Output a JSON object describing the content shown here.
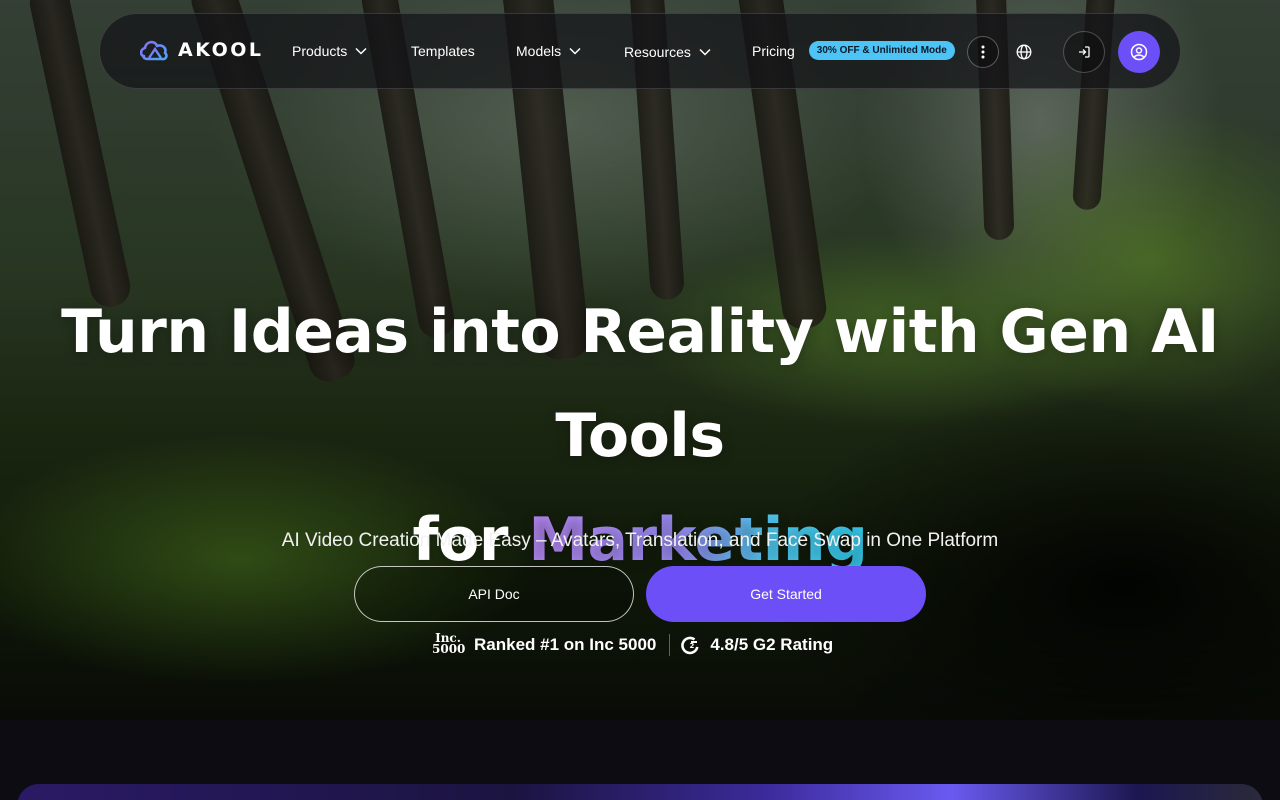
{
  "brand": {
    "name": "AKOOL"
  },
  "nav": {
    "items": [
      {
        "label": "Products",
        "has_dropdown": true
      },
      {
        "label": "Templates",
        "has_dropdown": false
      },
      {
        "label": "Models",
        "has_dropdown": true
      },
      {
        "label": "Resources",
        "has_dropdown": true
      },
      {
        "label": "Pricing",
        "has_dropdown": false
      }
    ],
    "pricing_badge": "30% OFF & Unlimited Mode",
    "icons": [
      "more-vertical-icon",
      "globe-icon",
      "login-icon",
      "user-icon"
    ]
  },
  "hero": {
    "headline_line1": "Turn Ideas into Reality with Gen AI Tools",
    "headline_line2_prefix": "for ",
    "headline_line2_accent": "Marketing",
    "subhead": "AI Video Creation Made Easy – Avatars, Translation, and Face Swap in One Platform",
    "cta_secondary": "API Doc",
    "cta_primary": "Get Started",
    "proof": {
      "inc_logo_top": "Inc.",
      "inc_logo_bottom": "5000",
      "inc_text": "Ranked #1 on Inc 5000",
      "g2_text": "4.8/5 G2 Rating"
    }
  },
  "colors": {
    "primary": "#6c4ff6",
    "badge": "#4cc4f5",
    "accent_gradient_start": "#b98af7",
    "accent_gradient_end": "#35d0f0"
  }
}
